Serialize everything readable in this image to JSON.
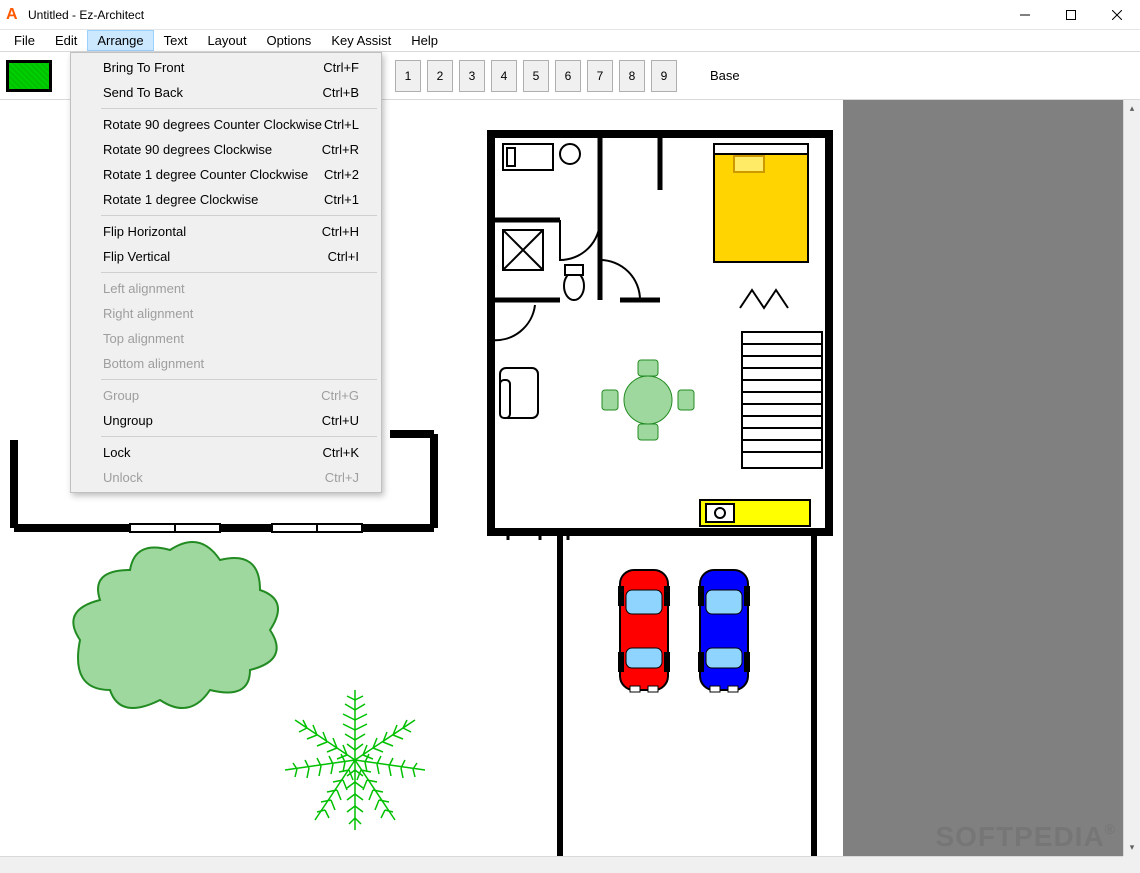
{
  "window": {
    "title": "Untitled - Ez-Architect"
  },
  "menubar": {
    "items": [
      "File",
      "Edit",
      "Arrange",
      "Text",
      "Layout",
      "Options",
      "Key Assist",
      "Help"
    ],
    "active_index": 2
  },
  "toolbar": {
    "layer_buttons": [
      "1",
      "2",
      "3",
      "4",
      "5",
      "6",
      "7",
      "8",
      "9"
    ],
    "layer_label": "Base"
  },
  "dropdown": {
    "groups": [
      [
        {
          "label": "Bring To Front",
          "shortcut": "Ctrl+F",
          "enabled": true
        },
        {
          "label": "Send To Back",
          "shortcut": "Ctrl+B",
          "enabled": true
        }
      ],
      [
        {
          "label": "Rotate 90 degrees Counter Clockwise",
          "shortcut": "Ctrl+L",
          "enabled": true
        },
        {
          "label": "Rotate 90 degrees Clockwise",
          "shortcut": "Ctrl+R",
          "enabled": true
        },
        {
          "label": "Rotate 1 degree Counter Clockwise",
          "shortcut": "Ctrl+2",
          "enabled": true
        },
        {
          "label": "Rotate 1 degree Clockwise",
          "shortcut": "Ctrl+1",
          "enabled": true
        }
      ],
      [
        {
          "label": "Flip Horizontal",
          "shortcut": "Ctrl+H",
          "enabled": true
        },
        {
          "label": "Flip Vertical",
          "shortcut": "Ctrl+I",
          "enabled": true
        }
      ],
      [
        {
          "label": "Left alignment",
          "shortcut": "",
          "enabled": false
        },
        {
          "label": "Right alignment",
          "shortcut": "",
          "enabled": false
        },
        {
          "label": "Top alignment",
          "shortcut": "",
          "enabled": false
        },
        {
          "label": "Bottom alignment",
          "shortcut": "",
          "enabled": false
        }
      ],
      [
        {
          "label": "Group",
          "shortcut": "Ctrl+G",
          "enabled": false
        },
        {
          "label": "Ungroup",
          "shortcut": "Ctrl+U",
          "enabled": true
        }
      ],
      [
        {
          "label": "Lock",
          "shortcut": "Ctrl+K",
          "enabled": true
        },
        {
          "label": "Unlock",
          "shortcut": "Ctrl+J",
          "enabled": false
        }
      ]
    ]
  },
  "watermark": {
    "text": "SOFTPEDIA",
    "symbol": "®"
  }
}
